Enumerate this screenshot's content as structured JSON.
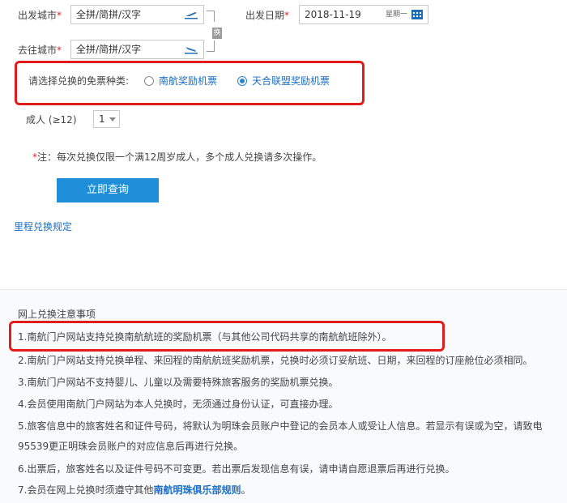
{
  "search": {
    "origin_label": "出发城市",
    "origin_placeholder": "全拼/简拼/汉字",
    "destination_label": "去往城市",
    "destination_placeholder": "全拼/简拼/汉字",
    "swap_label": "换",
    "date_label": "出发日期",
    "date_value": "2018-11-19",
    "weekday": "星期一",
    "required_mark": "*"
  },
  "ticket_type": {
    "prompt": "请选择兑换的免票种类:",
    "options": [
      {
        "label": "南航奖励机票",
        "checked": false
      },
      {
        "label": "天合联盟奖励机票",
        "checked": true
      }
    ]
  },
  "passengers": {
    "adult_label": "成人 (≥12)",
    "adult_value": "1"
  },
  "note": {
    "mark": "*",
    "text": "注：每次兑换仅限一个满12周岁成人，多个成人兑换请多次操作。"
  },
  "query_button": "立即查询",
  "rules_link": "里程兑换规定",
  "notice": {
    "title": "网上兑换注意事项",
    "items": [
      "1.南航门户网站支持兑换南航航班的奖励机票（与其他公司代码共享的南航航班除外）。",
      "2.南航门户网站支持兑换单程、来回程的南航航班奖励机票，兑换时必须订妥航班、日期，来回程的订座舱位必须相同。",
      "3.南航门户网站不支持婴儿、儿童以及需要特殊旅客服务的奖励机票兑换。",
      "4.会员使用南航门户网站为本人兑换时，无须通过身份认证，可直接办理。",
      "5.旅客信息中的旅客姓名和证件号码，将默认为明珠会员账户中登记的会员本人或受让人信息。若显示有误或为空，请致电",
      "95539更正明珠会员账户的对应信息后再进行兑换。",
      "6.出票后，旅客姓名以及证件号码不可变更。若出票后发现信息有误，请申请自愿退票后再进行兑换。"
    ],
    "item7_prefix": "7.会员在网上兑换时须遵守其他",
    "item7_link": "南航明珠俱乐部规则",
    "item7_suffix": "。"
  },
  "colors": {
    "accent": "#1e8fd8",
    "link": "#1a6fc7",
    "highlight": "#e21b1b"
  }
}
